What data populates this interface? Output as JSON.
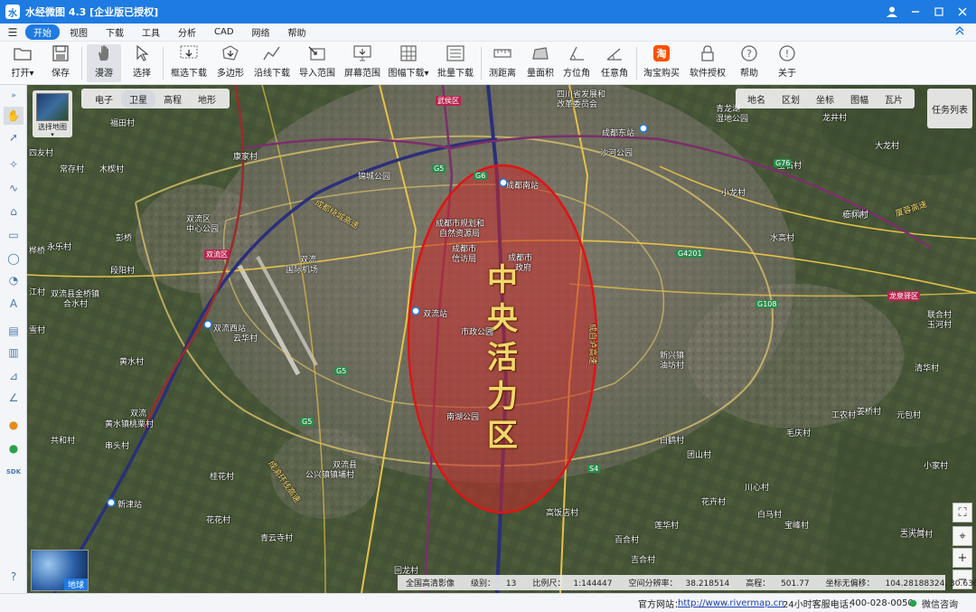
{
  "window": {
    "title": "水经微图 4.3 [企业版已授权]",
    "logo_text": "水"
  },
  "menu": {
    "items": [
      "开始",
      "视图",
      "下载",
      "工具",
      "分析",
      "CAD",
      "网络",
      "帮助"
    ],
    "active_index": 0
  },
  "toolbar": {
    "open": "打开",
    "open_arrow": "▾",
    "save": "保存",
    "roam": "漫游",
    "select": "选择",
    "rect_download": "框选下载",
    "polygon": "多边形",
    "line_download": "沿线下载",
    "import_range": "导入范围",
    "screen_range": "屏幕范围",
    "sheet_download": "图幅下载",
    "batch_download": "批量下载",
    "measure_distance": "测距离",
    "measure_area": "量面积",
    "bearing": "方位角",
    "any_angle": "任意角",
    "taobao": "淘宝购买",
    "license": "软件授权",
    "help": "帮助",
    "about": "关于"
  },
  "map": {
    "layer_tabs": [
      "电子",
      "卫星",
      "高程",
      "地形"
    ],
    "layer_active": 1,
    "right_tabs": [
      "地名",
      "区划",
      "坐标",
      "图幅",
      "瓦片"
    ],
    "task_list": "任务列表",
    "select_map_label": "选择地图",
    "globe_label": "地球",
    "overlay_text_chars": [
      "中",
      "央",
      "活",
      "力",
      "区"
    ],
    "labels": {
      "wuhou": "武侯区",
      "sichuan_gov": "四川省发展和",
      "sichuan_gov2": "改革委员会",
      "qingbaijiang": "青龙湖",
      "wetland": "湿地公园",
      "longjing": "龙井村",
      "dalong": "大龙村",
      "fuanle": "福田村",
      "sidongcun": "四友村",
      "changcun": "常存村",
      "mushao": "木楔村",
      "kangjia": "康家村",
      "chengdudong": "成都东站",
      "shahe": "沙河公园",
      "yuexiu": "桃秀村",
      "shuangliu_gov": "双流区",
      "shuangliu_gov2": "中心公园",
      "shuangliuqu": "双流区",
      "pengqiao": "彭桥",
      "huaqiao": "桦桥",
      "yongle": "永乐村",
      "duanxiao": "段阳村",
      "jiangcun": "江村",
      "shuangliu_jinqiao": "双流县金桥镇",
      "heshuicun": "合水村",
      "xuecun": "雪村",
      "airport": "双流",
      "airport2": "国际机场",
      "chengdu_ring": "成都绕城高速",
      "chengdu_nanzhan": "成都南站",
      "chengdu_plan": "成都市规划和",
      "chengdu_plan2": "自然资源局",
      "chengdu_xinfang": "成都市",
      "chengdu_xinfang2": "信访局",
      "chengdu_gov": "成都市",
      "chengdu_gov2": "政府",
      "shuangliuzhan": "双流站",
      "shizheng": "市政公园",
      "nanhu": "南湖公园",
      "shuangliu_xizhan": "双流西站",
      "yunhua": "云华村",
      "huangshui": "黄水村",
      "shuangliu_huangshui": "双流",
      "shuangliu_huangshui2": "黄水镇桃栗村",
      "gongcun": "共和村",
      "chuanjin": "串头村",
      "xinjin": "新津站",
      "guixing": "桂花村",
      "huahua": "花花村",
      "qingyun": "青云寺村",
      "shuangliu_gongxin": "双流县",
      "shuangliu_gongxin2": "公兴镇镇埔村",
      "jinrong": "成渝环线高速",
      "gaoyun": "高饭店村",
      "zhonghe": "中和镇",
      "fuguo": "富国村",
      "baihe": "白鹤村",
      "lihua": "莲华村",
      "baihe2": "百合村",
      "jiuhe": "吉合村",
      "huilong": "回龙村",
      "huilong2": "花卉村",
      "qiaogen": "桥根村",
      "xiaolong": "小龙村",
      "sunlian": "宝石村",
      "xingshu": "松林村",
      "shuiqiao": "水高村",
      "xingwu": "新兴镇",
      "youwu": "油坊村",
      "tuanshan": "团山村",
      "chuanxin": "川心村",
      "dongyi": "东一村",
      "baima": "白马村",
      "maoqing": "毛庆村",
      "tianlong": "天洪村",
      "longquanyi": "龙泉驿区",
      "lianhe": "联合村",
      "yuhe": "玉河村",
      "jiangshe": "姜桥村",
      "qinghua": "清华村",
      "baofeng": "宝峰村",
      "shuanghe": "双林村",
      "gongnong": "工农村",
      "yuanyuan": "元包村",
      "xiaojia": "小家村",
      "sanjiang": "三大湾村",
      "dongfeng": "东风村",
      "chengyu_ring": "成自泸高速",
      "xiamen": "厦蓉高速",
      "jinyuan": "锦城公园",
      "yuemin": "月尾村",
      "shunhe": "顺河村",
      "caixin": "蔡家村"
    },
    "road_tags": [
      "G5",
      "G6",
      "G76",
      "G4201",
      "S4",
      "G108",
      "G5",
      "G5"
    ]
  },
  "infobar": {
    "source": "全国高清影像",
    "level_label": "级别：",
    "level": "13",
    "scale_label": "比例尺：",
    "scale": "1:144447",
    "resolution_label": "空间分辨率：",
    "resolution": "38.218514",
    "elevation_label": "高程：",
    "elevation": "501.77",
    "coord_label": "坐标无偏移：",
    "coord": "104.28188324, 30.63673043"
  },
  "statusbar": {
    "website_label": "官方网站：",
    "website": "http://www.rivermap.cn",
    "phone_label": "24小时客服电话：",
    "phone": "400-028-0050",
    "wechat": "微信咨询"
  },
  "colors": {
    "accent": "#1e7be2",
    "overlay_fill": "#c82a2a",
    "overlay_stroke": "#e01414",
    "overlay_text": "#f0d96b"
  }
}
